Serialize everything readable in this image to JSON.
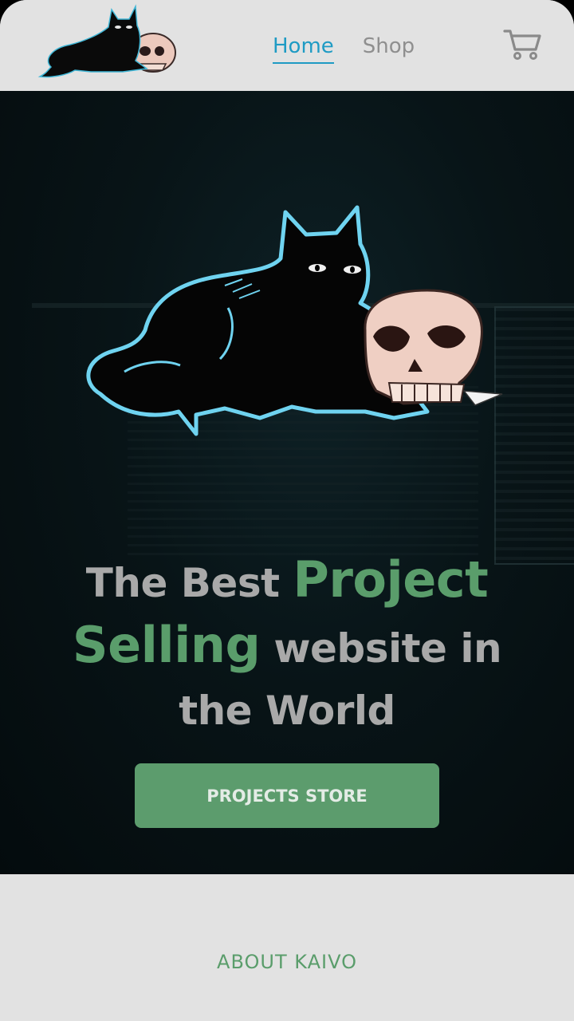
{
  "header": {
    "nav": [
      {
        "label": "Home",
        "active": true
      },
      {
        "label": "Shop",
        "active": false
      }
    ],
    "logo_icon": "cat-skull-logo",
    "cart_icon": "cart-icon"
  },
  "hero": {
    "art_icon": "cat-with-skull-illustration",
    "headline": {
      "part1": "The Best ",
      "accent1": "Project",
      "accent2": "Selling",
      "part2": " website in",
      "part3": "the World"
    },
    "cta_label": "PROJECTS STORE"
  },
  "about": {
    "title": "ABOUT KAIVO"
  },
  "colors": {
    "accent_green": "#5a9d6b",
    "nav_active": "#1f9bc4",
    "nav_inactive": "#8f8f8f",
    "header_bg": "#e2e2e2",
    "hero_bg": "#081417",
    "headline_gray": "#a9a9a9"
  }
}
